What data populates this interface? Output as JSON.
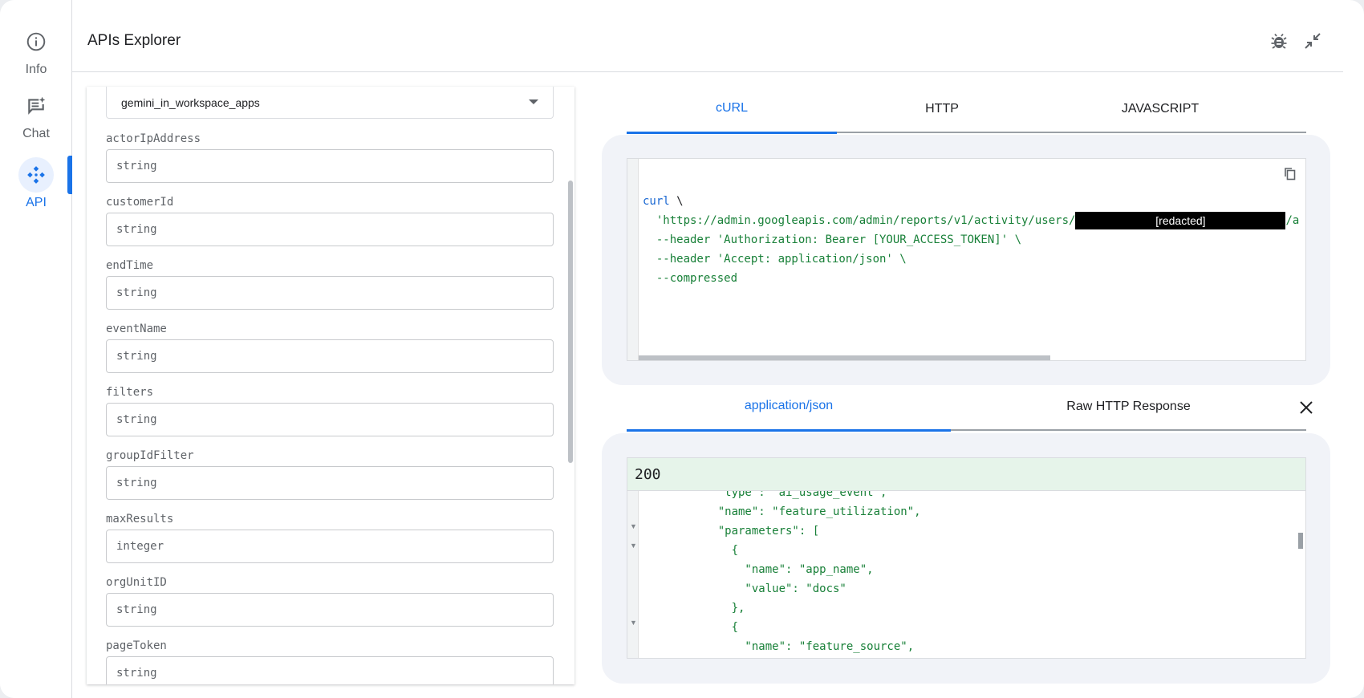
{
  "rail": {
    "items": [
      {
        "label": "Info"
      },
      {
        "label": "Chat"
      },
      {
        "label": "API"
      }
    ]
  },
  "header": {
    "title": "APIs Explorer"
  },
  "form": {
    "application_value": "gemini_in_workspace_apps",
    "fields": [
      {
        "label": "actorIpAddress",
        "placeholder": "string"
      },
      {
        "label": "customerId",
        "placeholder": "string"
      },
      {
        "label": "endTime",
        "placeholder": "string"
      },
      {
        "label": "eventName",
        "placeholder": "string"
      },
      {
        "label": "filters",
        "placeholder": "string"
      },
      {
        "label": "groupIdFilter",
        "placeholder": "string"
      },
      {
        "label": "maxResults",
        "placeholder": "integer"
      },
      {
        "label": "orgUnitID",
        "placeholder": "string"
      },
      {
        "label": "pageToken",
        "placeholder": "string"
      }
    ]
  },
  "request_tabs": [
    "cURL",
    "HTTP",
    "JAVASCRIPT"
  ],
  "curl": {
    "cmd": "curl",
    "line_end": " \\",
    "url_prefix": "  'https://admin.googleapis.com/admin/reports/v1/activity/users/",
    "redacted": "[redacted]",
    "url_suffix": "/a",
    "header_auth": "  --header 'Authorization: Bearer [YOUR_ACCESS_TOKEN]' \\",
    "header_accept": "  --header 'Accept: application/json' \\",
    "compressed": "  --compressed"
  },
  "response_tabs": [
    "application/json",
    "Raw HTTP Response"
  ],
  "response": {
    "status": "200",
    "lines": [
      "           \"type\": \"ai_usage_event\",",
      "           \"name\": \"feature_utilization\",",
      "           \"parameters\": [",
      "             {",
      "               \"name\": \"app_name\",",
      "               \"value\": \"docs\"",
      "             },",
      "             {",
      "               \"name\": \"feature_source\","
    ]
  }
}
